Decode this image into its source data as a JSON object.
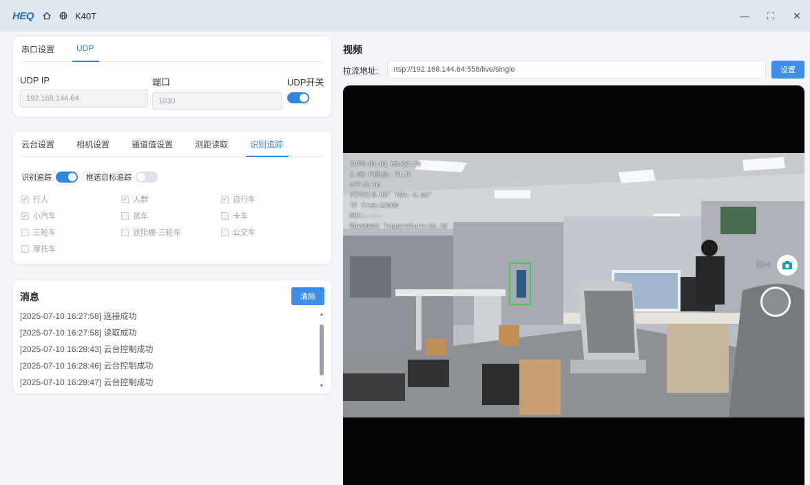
{
  "app": {
    "logo": "HEQ",
    "title": "K40T",
    "window_controls": {
      "minimize": "—",
      "maximize": "⛶",
      "close": "✕"
    }
  },
  "udp_panel": {
    "tabs": [
      "串口设置",
      "UDP"
    ],
    "active_tab": "UDP",
    "ip_label": "UDP IP",
    "ip_value": "192.168.144.64",
    "port_label": "端口",
    "port_value": "1030",
    "switch_label": "UDP开关",
    "switch_on": true
  },
  "track_panel": {
    "tabs": [
      "云台设置",
      "相机设置",
      "通道值设置",
      "测距读取",
      "识别追踪"
    ],
    "active_tab": "识别追踪",
    "recognize_label": "识别追踪",
    "recognize_on": true,
    "filter_label": "框选目标追踪",
    "filter_on": false,
    "checkboxes": [
      [
        {
          "label": "行人",
          "checked": true
        },
        {
          "label": "人群",
          "checked": true
        },
        {
          "label": "自行车",
          "checked": true
        }
      ],
      [
        {
          "label": "小汽车",
          "checked": true
        },
        {
          "label": "货车",
          "checked": false
        },
        {
          "label": "卡车",
          "checked": false
        }
      ],
      [
        {
          "label": "三轮车",
          "checked": false
        },
        {
          "label": "遮阳棚-三轮车",
          "checked": false
        },
        {
          "label": "公交车",
          "checked": false
        }
      ],
      [
        {
          "label": "摩托车",
          "checked": false
        }
      ]
    ]
  },
  "messages": {
    "title": "消息",
    "clear_label": "清除",
    "lines": [
      "[2025-07-10 16:27:58] 连接成功",
      "[2025-07-10 16:27:58] 读取成功",
      "[2025-07-10 16:28:43] 云台控制成功",
      "[2025-07-10 16:28:46] 云台控制成功",
      "[2025-07-10 16:28:47] 云台控制成功"
    ]
  },
  "video": {
    "title": "视频",
    "url_label": "拉流地址:",
    "url_value": "rtsp://192.168.144.64:558/live/single",
    "set_label": "设置",
    "osd": [
      "1970-01-01 00:02:20",
      "1.0X  FIELD: 71.0",
      "LFP:8.1m",
      "PITCH:0.00° YAW:-0.63°",
      "TF free:119Gb",
      "REC:--:--",
      "Movement Temperature:56.38"
    ]
  },
  "colors": {
    "accent": "#2e86de",
    "titlebar": "#dfe8f1",
    "video_bg": "#050505"
  }
}
